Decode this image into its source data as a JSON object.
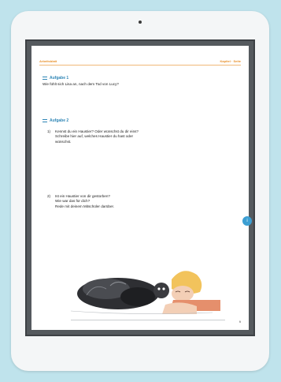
{
  "header": {
    "left_text": "Arbeitsblatt",
    "right_text": "Kapitel · Seite"
  },
  "task1": {
    "heading": "Aufgabe 1",
    "text": "Wie fühlt sich Lisa an, nach dem Tod von Lucy?"
  },
  "task2": {
    "heading": "Aufgabe 2",
    "items": [
      {
        "num": "1)",
        "lines": [
          "Kennst du ein Haustier? Oder wünschst du dir eins?",
          "Schreibe hier auf, welches Haustier du hast oder",
          "wünschst."
        ]
      },
      {
        "num": "2)",
        "lines": [
          "Ist ein Haustier von dir gestorben?",
          "Wie war das für dich?",
          "Rede mit deinem Mitschüler darüber."
        ]
      }
    ]
  },
  "side_button": {
    "label": "i"
  },
  "page_number": "9",
  "icons": {
    "list": "list-icon",
    "info": "info-icon"
  },
  "colors": {
    "accent_orange": "#e8902a",
    "heading_blue": "#2f86b6",
    "background": "#bfe3ec"
  }
}
